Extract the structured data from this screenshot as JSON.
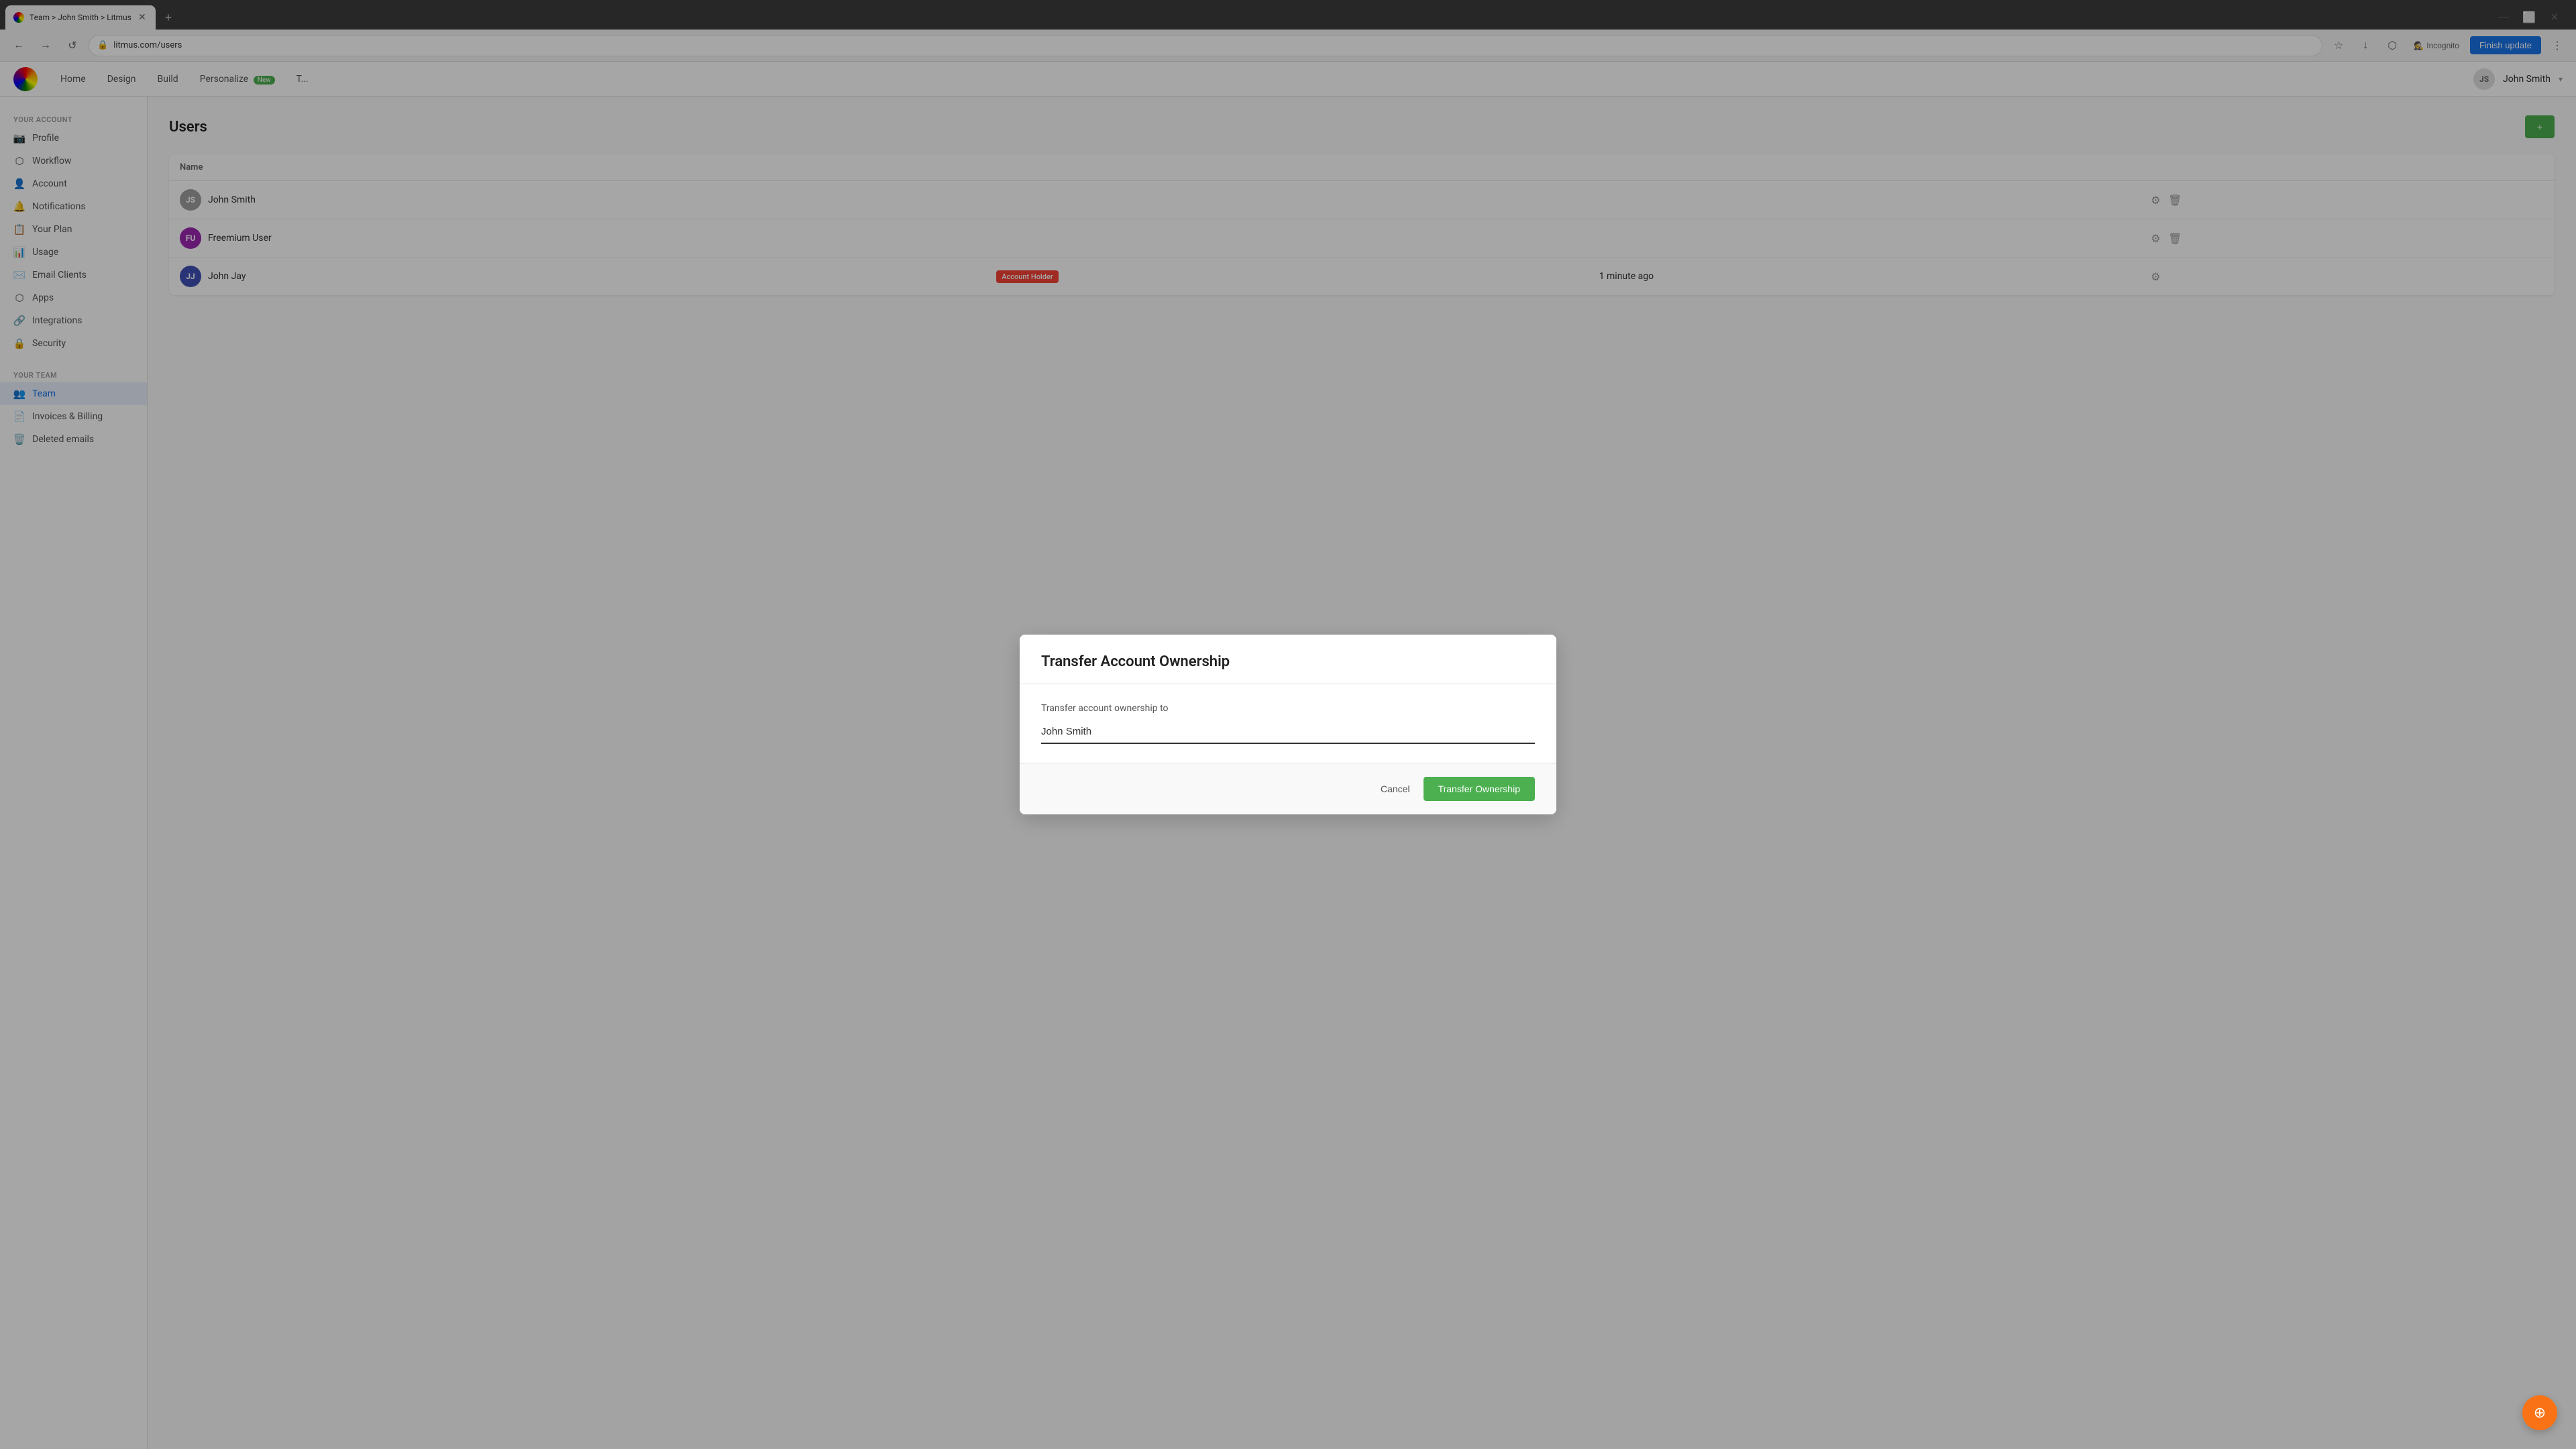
{
  "browser": {
    "tab_title": "Team > John Smith > Litmus",
    "favicon_alt": "Litmus favicon",
    "new_tab_icon": "+",
    "nav_back": "←",
    "nav_forward": "→",
    "nav_refresh": "↺",
    "address": "litmus.com/users",
    "bookmark_icon": "☆",
    "download_icon": "↓",
    "extensions_icon": "⬡",
    "incognito_label": "Incognito",
    "finish_update_label": "Finish update",
    "menu_icon": "⋮"
  },
  "app_header": {
    "nav_items": [
      {
        "label": "Home",
        "active": false
      },
      {
        "label": "Design",
        "active": false
      },
      {
        "label": "Build",
        "active": false
      },
      {
        "label": "Personalize",
        "badge": "New",
        "active": false
      },
      {
        "label": "T...",
        "active": false
      }
    ],
    "user_name": "John Smith",
    "user_initials": "JS"
  },
  "sidebar": {
    "your_account_label": "YOUR ACCOUNT",
    "your_team_label": "YOUR TEAM",
    "account_items": [
      {
        "icon": "📷",
        "label": "Profile",
        "active": false
      },
      {
        "icon": "⬡",
        "label": "Workflow",
        "active": false
      },
      {
        "icon": "👤",
        "label": "Account",
        "active": false
      },
      {
        "icon": "🔔",
        "label": "Notifications",
        "active": false
      },
      {
        "icon": "📋",
        "label": "Your Plan",
        "active": false
      },
      {
        "icon": "📊",
        "label": "Usage",
        "active": false
      },
      {
        "icon": "✉️",
        "label": "Email Clients",
        "active": false
      },
      {
        "icon": "⬡",
        "label": "Apps",
        "active": false
      },
      {
        "icon": "🔗",
        "label": "Integrations",
        "active": false
      },
      {
        "icon": "🔒",
        "label": "Security",
        "active": false
      }
    ],
    "team_items": [
      {
        "icon": "👥",
        "label": "Team",
        "active": true
      },
      {
        "icon": "📄",
        "label": "Invoices & Billing",
        "active": false
      },
      {
        "icon": "🗑️",
        "label": "Deleted emails",
        "active": false
      }
    ]
  },
  "main": {
    "page_title": "Users",
    "add_user_btn": "+",
    "table": {
      "columns": [
        "Name",
        "",
        "",
        ""
      ],
      "rows": [
        {
          "name": "John Smith",
          "badge": "",
          "time": "",
          "initials": "JS",
          "color": "#9e9e9e"
        },
        {
          "name": "Freemium User",
          "badge": "",
          "time": "",
          "initials": "FU",
          "color": "#9c27b0"
        },
        {
          "name": "John Jay",
          "badge": "Account Holder",
          "time": "1 minute ago",
          "initials": "JJ",
          "color": "#3f51b5"
        }
      ]
    }
  },
  "modal": {
    "title": "Transfer Account Ownership",
    "label": "Transfer account ownership to",
    "input_value": "John Smith",
    "cancel_label": "Cancel",
    "transfer_label": "Transfer Ownership"
  },
  "support_fab": {
    "icon": "⊕"
  }
}
